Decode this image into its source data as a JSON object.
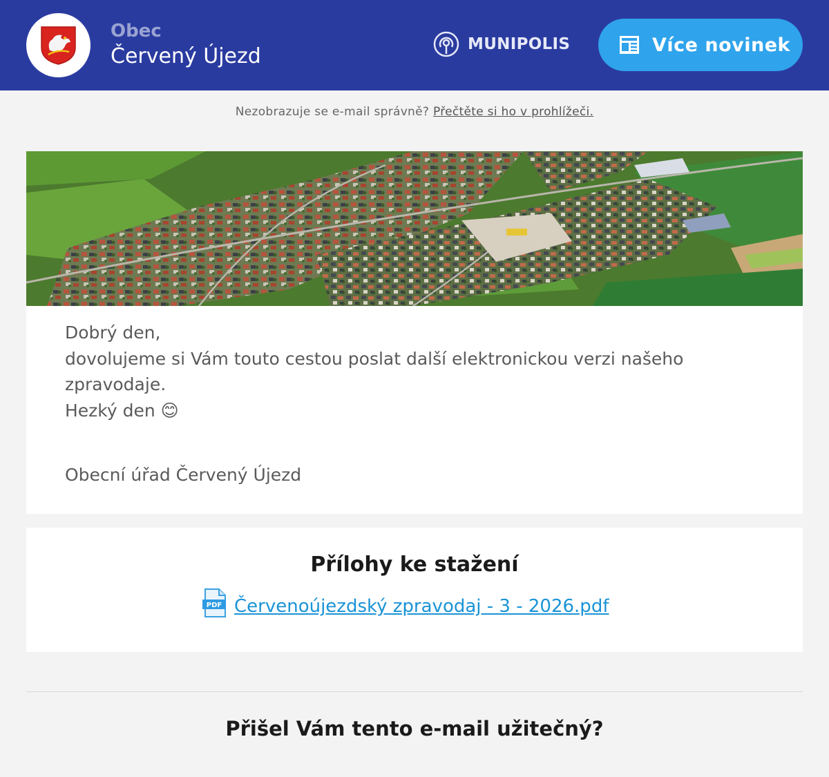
{
  "header": {
    "brand_small": "Obec",
    "brand_name": "Červený Újezd",
    "platform_name": "MUNIPOLIS",
    "more_button_label": "Více novinek",
    "colors": {
      "header_bg": "#2a3ba0",
      "button_bg": "#2fa3ec"
    }
  },
  "notice": {
    "text": "Nezobrazuje se e-mail správně?",
    "link": "Přečtěte si ho v prohlížeči."
  },
  "message": {
    "line1": "Dobrý den,",
    "line2": "dovolujeme si Vám touto cestou poslat další elektronickou verzi našeho zpravodaje.",
    "line3": "Hezký den 😊",
    "signature": "Obecní úřad Červený Újezd"
  },
  "attachments": {
    "title": "Přílohy ke stažení",
    "items": [
      {
        "name": "Červenoújezdský zpravodaj - 3 - 2026.pdf",
        "icon": "pdf-icon"
      }
    ]
  },
  "feedback": {
    "question": "Přišel Vám tento e-mail užitečný?"
  }
}
